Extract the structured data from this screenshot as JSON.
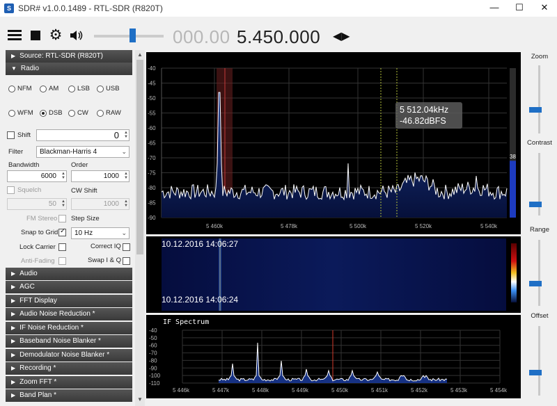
{
  "window": {
    "title": "SDR# v1.0.0.1489 - RTL-SDR (R820T)",
    "icon": "sdrsharp-logo",
    "minimize": "—",
    "maximize": "☐",
    "close": "✕"
  },
  "toolbar": {
    "freq_dim": "000.00",
    "freq_main": "5.450.000",
    "tune_arrows": "◀▶",
    "icons": [
      "menu-icon",
      "stop-icon",
      "gear-icon",
      "speaker-icon"
    ],
    "volume_level": 0.55
  },
  "sections": {
    "source": "Source: RTL-SDR (R820T)",
    "radio": "Radio",
    "audio": "Audio",
    "agc": "AGC",
    "fft": "FFT Display",
    "audio_nr": "Audio Noise Reduction *",
    "if_nr": "IF Noise Reduction *",
    "baseband_nb": "Baseband Noise Blanker *",
    "demod_nb": "Demodulator Noise Blanker *",
    "recording": "Recording *",
    "zoom_fft": "Zoom FFT *",
    "band_plan": "Band Plan *"
  },
  "radio": {
    "modes": [
      "NFM",
      "AM",
      "LSB",
      "USB",
      "WFM",
      "DSB",
      "CW",
      "RAW"
    ],
    "selected_mode": "DSB",
    "shift_label": "Shift",
    "shift_value": "0",
    "filter_label": "Filter",
    "filter_value": "Blackman-Harris 4",
    "bandwidth_label": "Bandwidth",
    "bandwidth_value": "6000",
    "order_label": "Order",
    "order_value": "1000",
    "squelch_label": "Squelch",
    "squelch_value": "50",
    "cwshift_label": "CW Shift",
    "cwshift_value": "1000",
    "fmstereo_label": "FM Stereo",
    "stepsize_label": "Step Size",
    "snap_label": "Snap to Grid",
    "step_value": "10 Hz",
    "lockcarrier_label": "Lock Carrier",
    "correctiq_label": "Correct IQ",
    "antifading_label": "Anti-Fading",
    "swapiq_label": "Swap I & Q"
  },
  "spectrum": {
    "tooltip_freq": "5 512.04kHz",
    "tooltip_db": "-46.82dBFS",
    "y_ticks": [
      "-40",
      "-45",
      "-50",
      "-55",
      "-60",
      "-65",
      "-70",
      "-75",
      "-80",
      "-85",
      "-90"
    ],
    "x_ticks": [
      "5 460k",
      "5 478k",
      "5 500k",
      "5 520k",
      "5 540k"
    ],
    "x_values_khz": [
      5460,
      5478,
      5500,
      5520,
      5540
    ],
    "level_value": "38",
    "level_fraction": 0.38
  },
  "waterfall": {
    "time_top": "10.12.2016 14:06:27",
    "time_bottom": "10.12.2016 14:06:24"
  },
  "if_spectrum": {
    "title": "IF Spectrum",
    "y_ticks": [
      "-40",
      "-50",
      "-60",
      "-70",
      "-80",
      "-90",
      "-100",
      "-110"
    ],
    "x_ticks": [
      "5 446k",
      "5 447k",
      "5 448k",
      "5 449k",
      "5 450k",
      "5 451k",
      "5 452k",
      "5 453k",
      "5 454k"
    ]
  },
  "right_panel": {
    "zoom_label": "Zoom",
    "contrast_label": "Contrast",
    "range_label": "Range",
    "offset_label": "Offset"
  }
}
